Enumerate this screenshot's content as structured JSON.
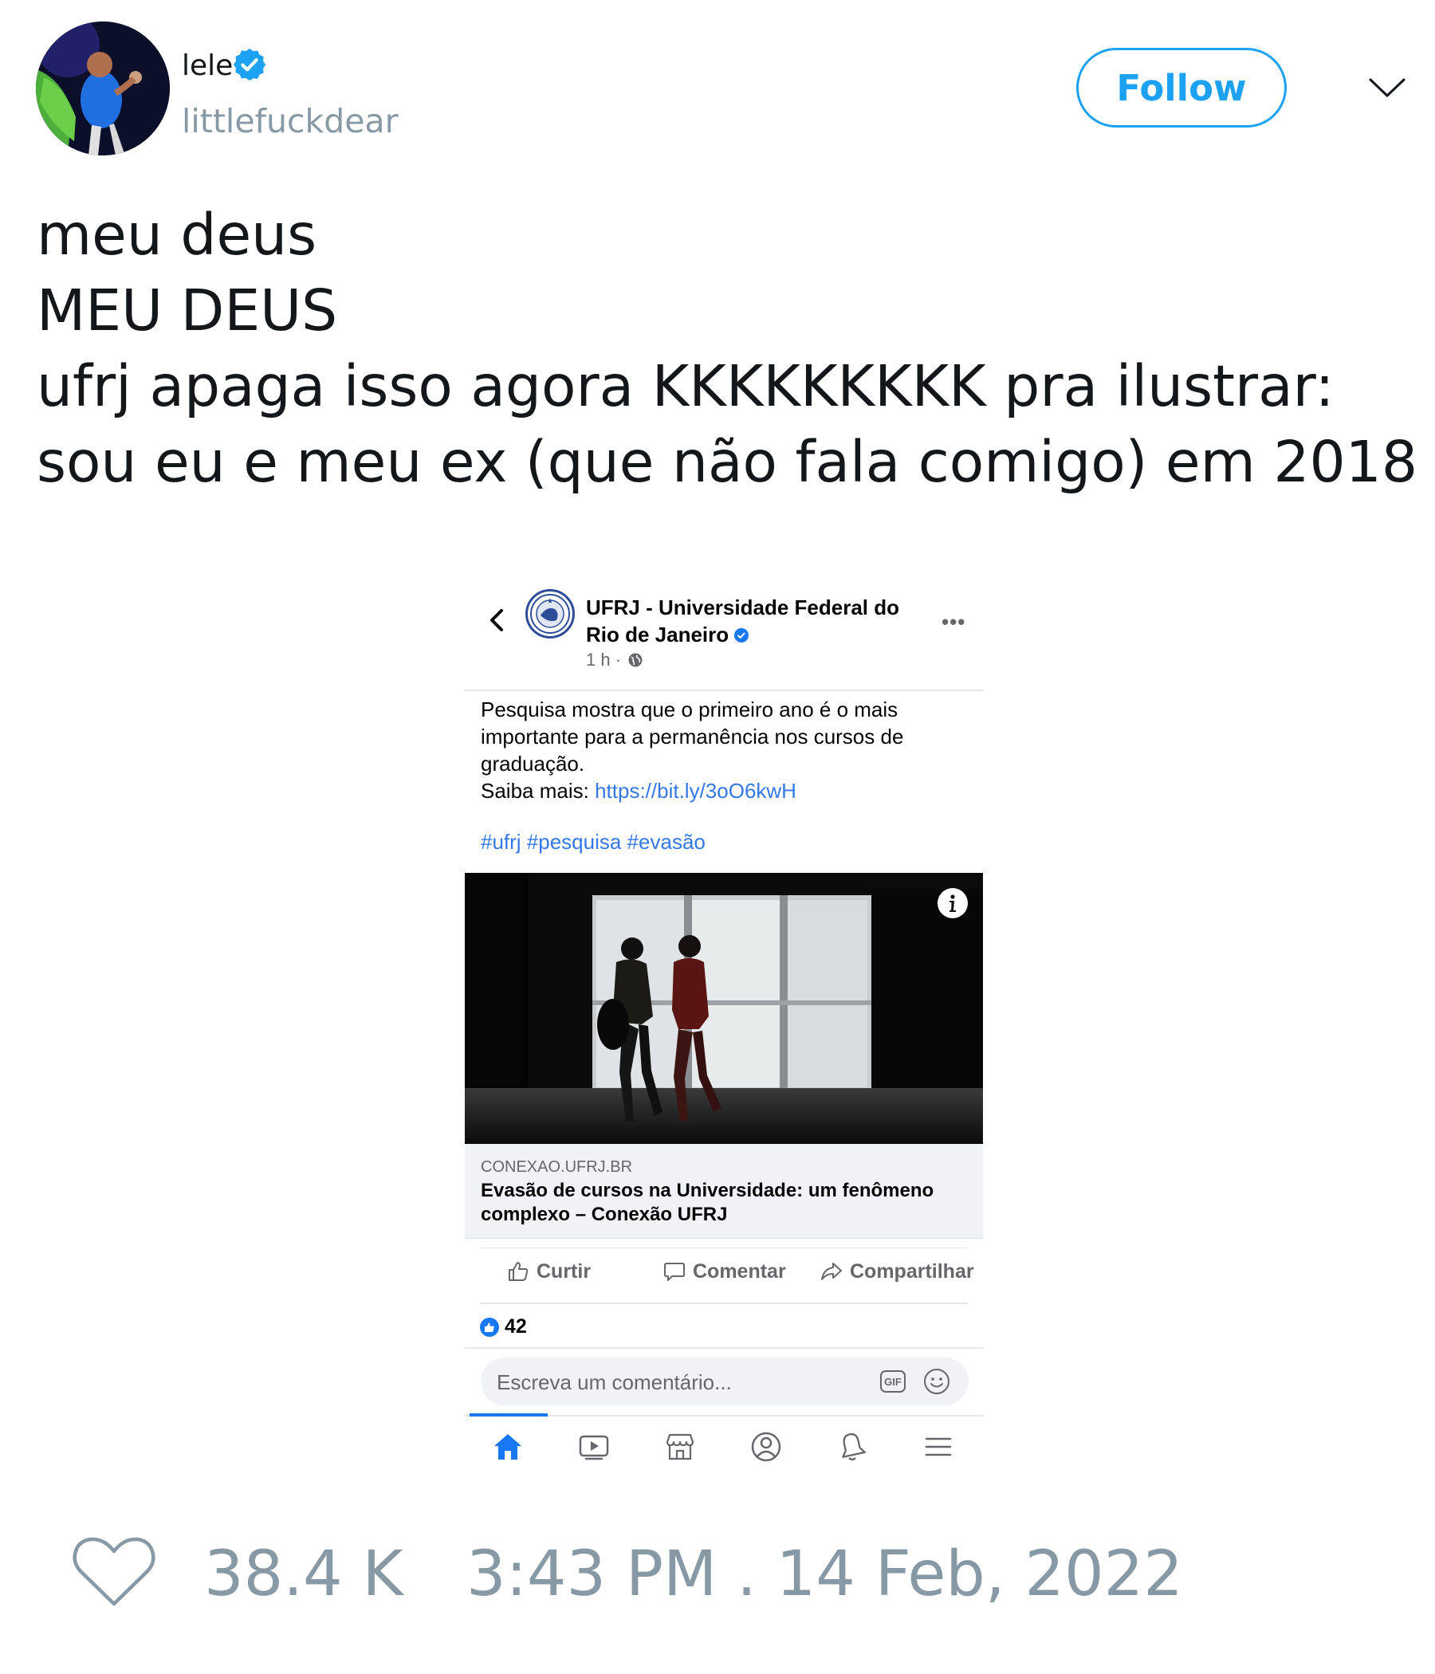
{
  "user": {
    "display_name": "lele",
    "handle": "littlefuckdear",
    "follow_label": "Follow"
  },
  "tweet": {
    "lines": [
      "meu deus",
      "MEU DEUS",
      "ufrj apaga isso agora KKKKKKKKK pra ilustrar:",
      "sou eu e meu ex (que não fala comigo) em 2018"
    ]
  },
  "fb_post": {
    "page_name_line1": "UFRJ - Universidade Federal do",
    "page_name_line2": "Rio de Janeiro",
    "time": "1 h ·",
    "body_line1": "Pesquisa mostra que o primeiro ano é o mais",
    "body_line2": "importante para a permanência nos cursos de",
    "body_line3": "graduação.",
    "saiba_label": "Saiba mais: ",
    "link": "https://bit.ly/3oO6kwH",
    "hashtags": "#ufrj #pesquisa #evasão",
    "domain": "CONEXAO.UFRJ.BR",
    "link_title": "Evasão de cursos na Universidade: um fenômeno complexo – Conexão UFRJ",
    "actions": {
      "like": "Curtir",
      "comment": "Comentar",
      "share": "Compartilhar"
    },
    "reaction_count": "42",
    "comment_placeholder": "Escreva um comentário...",
    "gif_label": "GIF",
    "more_label": "•••"
  },
  "footer": {
    "likes": "38.4 K",
    "timestamp": "3:43 PM . 14 Feb, 2022"
  },
  "colors": {
    "twitter_blue": "#1da1f2",
    "muted": "#8899a6",
    "fb_blue": "#1877f2",
    "fb_link": "#3578e5"
  }
}
